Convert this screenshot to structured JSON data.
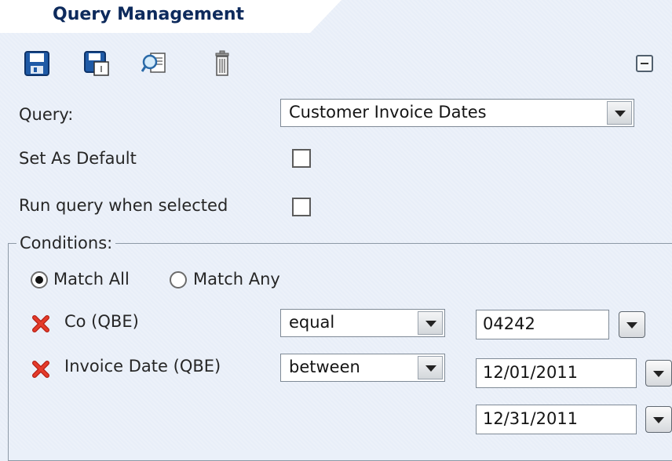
{
  "header": {
    "title": "Query Management"
  },
  "toolbar": {
    "icons": [
      "save-icon",
      "save-as-icon",
      "preview-icon",
      "delete-icon"
    ],
    "collapse_icon": "collapse-icon"
  },
  "form": {
    "query_label": "Query:",
    "query_value": "Customer Invoice Dates",
    "set_default_label": "Set As Default",
    "set_default_checked": false,
    "run_query_label": "Run query when selected",
    "run_query_checked": false
  },
  "conditions": {
    "legend": "Conditions:",
    "match_all_label": "Match All",
    "match_any_label": "Match Any",
    "selected_match": "Match All",
    "rows": [
      {
        "field": "Co (QBE)",
        "operator": "equal",
        "values": [
          "04242"
        ]
      },
      {
        "field": "Invoice Date (QBE)",
        "operator": "between",
        "values": [
          "12/01/2011",
          "12/31/2011"
        ]
      }
    ]
  },
  "colors": {
    "panel_bg": "#e8eef8",
    "title": "#0d2a5c",
    "remove_icon": "#d62a1e"
  }
}
